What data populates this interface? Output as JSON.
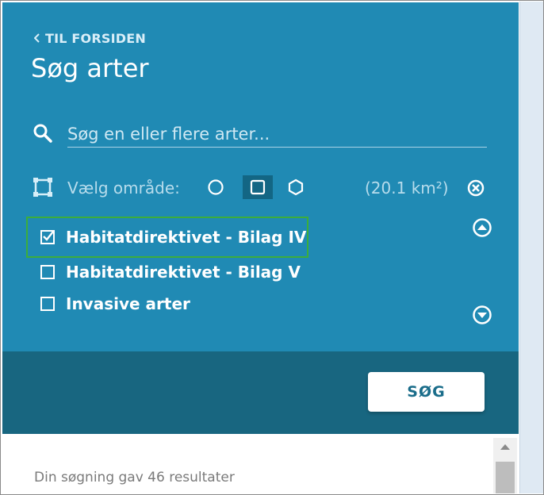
{
  "header": {
    "back_link": "TIL FORSIDEN",
    "title": "Søg arter"
  },
  "search": {
    "placeholder": "Søg en eller flere arter..."
  },
  "area": {
    "label": "Vælg område:",
    "value": "(20.1 km²)",
    "shapes": [
      "circle",
      "square",
      "hexagon"
    ],
    "selected_shape": "square"
  },
  "list": {
    "items": [
      {
        "label": "Habitatdirektivet - Bilag IV",
        "checked": true
      },
      {
        "label": "Habitatdirektivet - Bilag V",
        "checked": false
      },
      {
        "label": "Invasive arter",
        "checked": false
      }
    ]
  },
  "footer": {
    "search_button": "SØG"
  },
  "results": {
    "summary": "Din søgning gav 46 resultater"
  },
  "colors": {
    "panel": "#208ab4",
    "footer": "#186680",
    "focus_outline": "#3cad3c"
  }
}
